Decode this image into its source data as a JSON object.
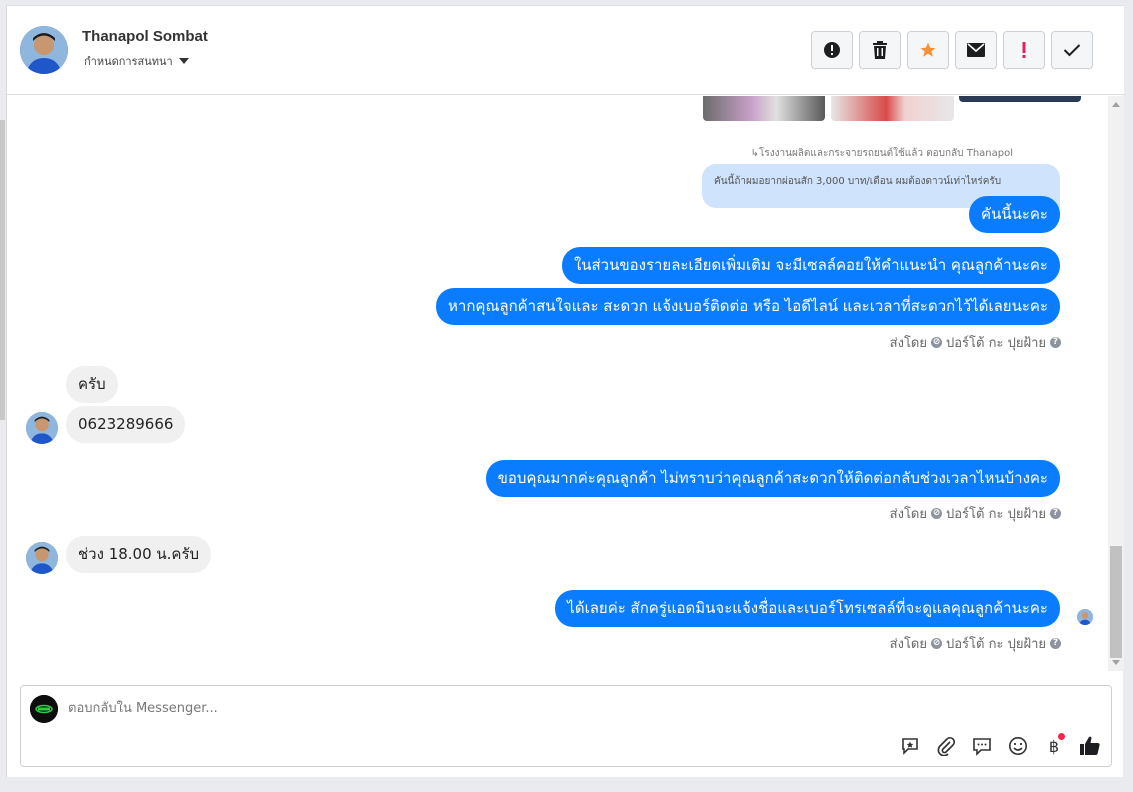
{
  "header": {
    "contact_name": "Thanapol Sombat",
    "assign_label": "กำหนดการสนทนา",
    "toolbar": [
      {
        "name": "spam",
        "icon": "exclamation-circle-icon"
      },
      {
        "name": "delete",
        "icon": "trash-icon"
      },
      {
        "name": "star",
        "icon": "star-icon"
      },
      {
        "name": "unread",
        "icon": "envelope-icon"
      },
      {
        "name": "important",
        "icon": "exclamation-icon"
      },
      {
        "name": "done",
        "icon": "check-icon"
      }
    ]
  },
  "conversation": {
    "reply_label": "↳โรงงานผลิตและกระจายรถยนต์ใช้แล้ว ตอบกลับ Thanapol",
    "quoted_text": "คันนี้ถ้าผมอยากผ่อนสัก 3,000 บาท/เดือน ผมต้องดาวน์เท่าไหร่ครับ",
    "messages": [
      {
        "direction": "out",
        "text": "คันนี้นะคะ"
      },
      {
        "direction": "out",
        "text": "ในส่วนของรายละเอียดเพิ่มเติม จะมีเซลล์คอยให้คำแนะนำ คุณลูกค้านะคะ"
      },
      {
        "direction": "out",
        "text": "หากคุณลูกค้าสนใจและ สะดวก แจ้งเบอร์ติดต่อ หรือ ไอดีไลน์ และเวลาที่สะดวกไว้ได้เลยนะคะ"
      },
      {
        "direction": "in",
        "text": "ครับ"
      },
      {
        "direction": "in",
        "text": "0623289666"
      },
      {
        "direction": "out",
        "text": "ขอบคุณมากค่ะคุณลูกค้า ไม่ทราบว่าคุณลูกค้าสะดวกให้ติดต่อกลับช่วงเวลาไหนบ้างคะ"
      },
      {
        "direction": "in",
        "text": "ช่วง 18.00 น.ครับ"
      },
      {
        "direction": "out",
        "text": "ได้เลยค่ะ สักครู่แอดมินจะแจ้งชื่อและเบอร์โทรเซลล์ที่จะดูแลคุณลูกค้านะคะ"
      }
    ],
    "sent_by_prefix": "ส่งโดย",
    "sent_by_name": "ปอร์โต้ กะ ปุยฝ้าย"
  },
  "composer": {
    "placeholder": "ตอบกลับใน Messenger...",
    "tools": [
      "saved-reply-icon",
      "attachment-icon",
      "chat-bubble-icon",
      "emoji-icon",
      "baht-payment-icon",
      "thumbs-up-icon"
    ]
  },
  "colors": {
    "outgoing_bubble": "#0a7cff",
    "incoming_bubble": "#f0f0f0",
    "quoted_bubble": "#cfe3fc",
    "star": "#f7923a",
    "important": "#e0245e"
  }
}
